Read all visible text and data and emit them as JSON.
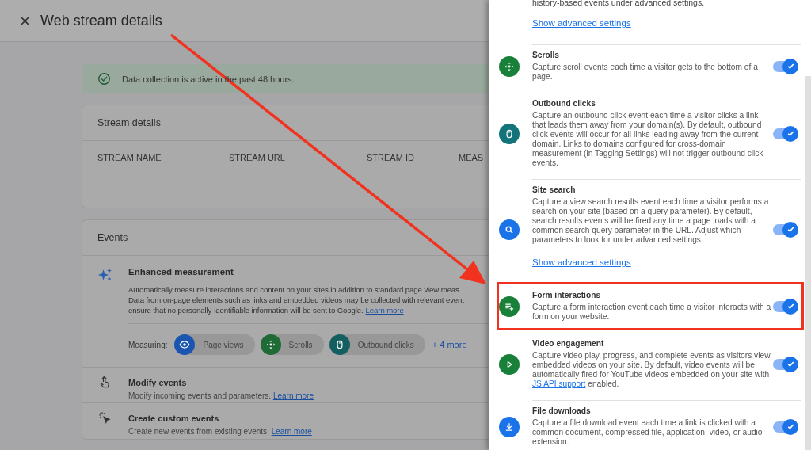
{
  "header": {
    "title": "Web stream details"
  },
  "status_banner": {
    "text": "Data collection is active in the past 48 hours."
  },
  "stream_details": {
    "title": "Stream details",
    "columns": [
      "STREAM NAME",
      "STREAM URL",
      "STREAM ID",
      "MEAS"
    ]
  },
  "events": {
    "title": "Events",
    "enhanced_measurement": {
      "title": "Enhanced measurement",
      "description_lines": [
        "Automatically measure interactions and content on your sites in addition to standard page view meas",
        "Data from on-page elements such as links and embedded videos may be collected with relevant event",
        "ensure that no personally-identifiable information will be sent to Google."
      ],
      "link": "Learn more",
      "measuring_label": "Measuring:",
      "chips": [
        {
          "label": "Page views",
          "kind": "eye",
          "color": "#1a56b0"
        },
        {
          "label": "Scrolls",
          "kind": "scroll",
          "color": "#1f6a35"
        },
        {
          "label": "Outbound clicks",
          "kind": "mouse",
          "color": "#165f60"
        }
      ],
      "more": "+ 4 more"
    },
    "rows": [
      {
        "kind": "touch",
        "title": "Modify events",
        "description": "Modify incoming events and parameters.",
        "link": "Learn more"
      },
      {
        "kind": "click",
        "title": "Create custom events",
        "description": "Create new events from existing events.",
        "link": "Learn more"
      }
    ]
  },
  "settings_panel": {
    "intro": "history-based events under advanced settings.",
    "intro_link": "Show advanced settings",
    "items": [
      {
        "kind": "scroll",
        "color": "#188038",
        "title": "Scrolls",
        "description": "Capture scroll events each time a visitor gets to the bottom of a page.",
        "on": true,
        "highlighted": false
      },
      {
        "kind": "mouse",
        "color": "#12737a",
        "title": "Outbound clicks",
        "description": "Capture an outbound click event each time a visitor clicks a link that leads them away from your domain(s). By default, outbound click events will occur for all links leading away from the current domain. Links to domains configured for cross-domain measurement (in Tagging Settings) will not trigger outbound click events.",
        "on": true,
        "highlighted": false
      },
      {
        "kind": "search",
        "color": "#1a73e8",
        "title": "Site search",
        "description": "Capture a view search results event each time a visitor performs a search on your site (based on a query parameter). By default, search results events will be fired any time a page loads with a common search query parameter in the URL. Adjust which parameters to look for under advanced settings.",
        "after_link": "Show advanced settings",
        "on": true,
        "highlighted": false
      },
      {
        "kind": "form",
        "color": "#188038",
        "title": "Form interactions",
        "description": "Capture a form interaction event each time a visitor interacts with a form on your website.",
        "on": true,
        "highlighted": true
      },
      {
        "kind": "play",
        "color": "#188038",
        "title": "Video engagement",
        "description": "Capture video play, progress, and complete events as visitors view embedded videos on your site. By default, video events will be automatically fired for YouTube videos embedded on your site with",
        "inline_link": "JS API support",
        "description_end": "enabled.",
        "on": true,
        "highlighted": false
      },
      {
        "kind": "download",
        "color": "#1a73e8",
        "title": "File downloads",
        "description": "Capture a file download event each time a link is clicked with a common document, compressed file, application, video, or audio extension.",
        "on": true,
        "highlighted": false
      }
    ]
  }
}
